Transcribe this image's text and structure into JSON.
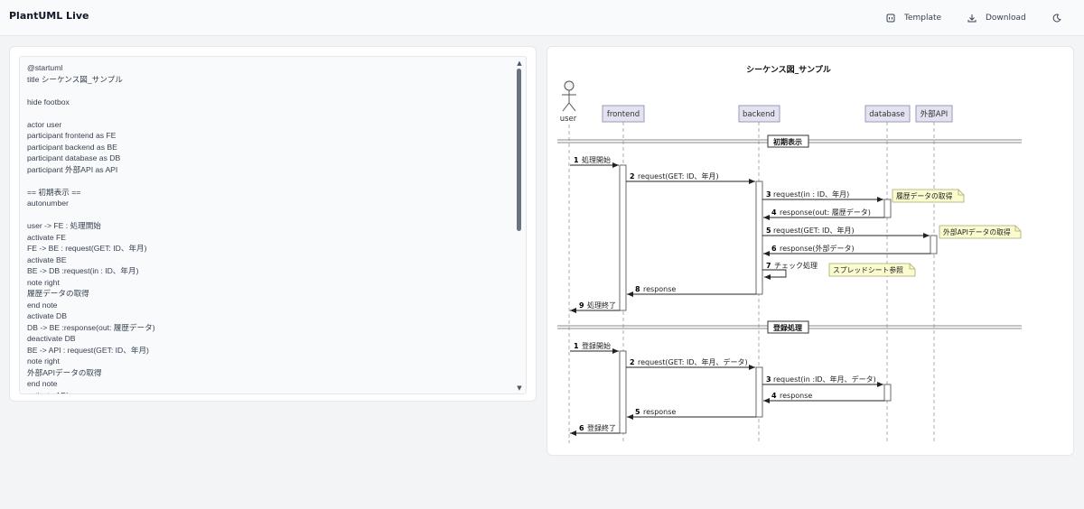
{
  "header": {
    "app_title": "PlantUML Live",
    "template_label": "Template",
    "download_label": "Download"
  },
  "editor": {
    "lines": [
      "@startuml",
      "title シーケンス図_サンプル",
      "",
      "hide footbox",
      "",
      "actor user",
      "participant frontend as FE",
      "participant backend as BE",
      "participant database as DB",
      "participant 外部API as API",
      "",
      "== 初期表示 ==",
      "autonumber",
      "",
      "user -> FE : 処理開始",
      "activate FE",
      "FE -> BE : request(GET: ID、年月)",
      "activate BE",
      "BE -> DB :request(in : ID、年月)",
      "note right",
      "履歴データの取得",
      "end note",
      "activate DB",
      "DB -> BE :response(out: 履歴データ)",
      "deactivate DB",
      "BE -> API : request(GET: ID、年月)",
      "note right",
      "外部APIデータの取得",
      "end note",
      "activate API"
    ]
  },
  "diagram": {
    "title": "シーケンス図_サンプル",
    "actor": "user",
    "participants": [
      "frontend",
      "backend",
      "database",
      "外部API"
    ],
    "sections": [
      "初期表示",
      "登録処理"
    ],
    "messages_1": [
      {
        "num": "1",
        "label": "処理開始"
      },
      {
        "num": "2",
        "label": "request(GET: ID、年月)"
      },
      {
        "num": "3",
        "label": "request(in : ID、年月)"
      },
      {
        "num": "4",
        "label": "response(out: 履歴データ)"
      },
      {
        "num": "5",
        "label": "request(GET: ID、年月)"
      },
      {
        "num": "6",
        "label": "response(外部データ)"
      },
      {
        "num": "7",
        "label": "チェック処理"
      },
      {
        "num": "8",
        "label": "response"
      },
      {
        "num": "9",
        "label": "処理終了"
      }
    ],
    "notes": [
      "履歴データの取得",
      "外部APIデータの取得",
      "スプレッドシート参照"
    ],
    "messages_2": [
      {
        "num": "1",
        "label": "登録開始"
      },
      {
        "num": "2",
        "label": "request(GET: ID、年月、データ)"
      },
      {
        "num": "3",
        "label": "request(in :ID、年月、データ)"
      },
      {
        "num": "4",
        "label": "response"
      },
      {
        "num": "5",
        "label": "response"
      },
      {
        "num": "6",
        "label": "登録終了"
      }
    ]
  }
}
